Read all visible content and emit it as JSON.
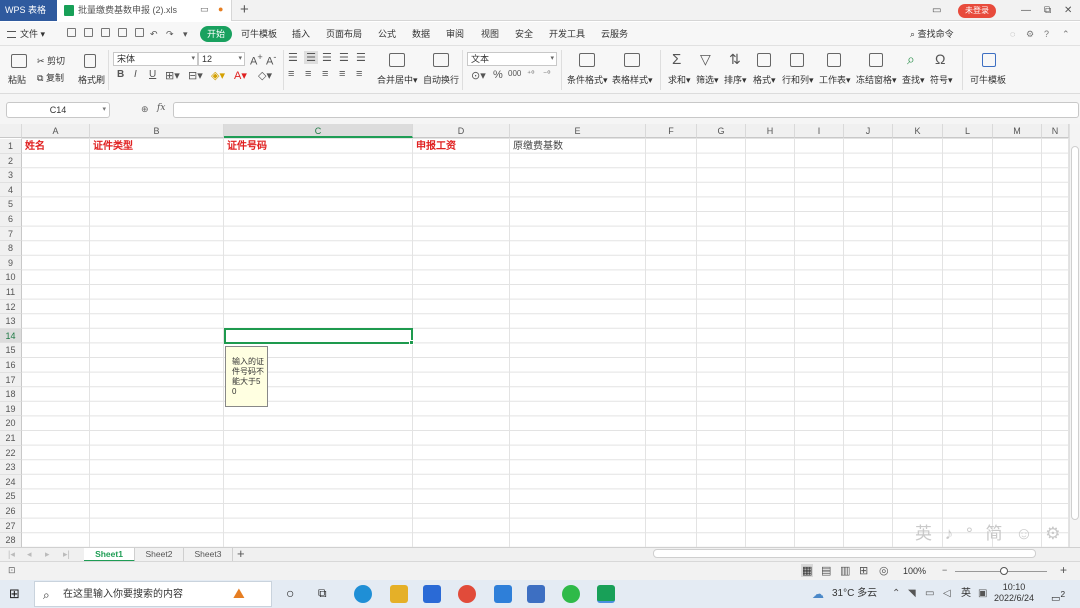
{
  "titlebar": {
    "brand": "WPS 表格",
    "file_tab": "批量缴费基数申报 (2).xls",
    "login": "未登录"
  },
  "menu": {
    "file": "文件",
    "items": [
      "开始",
      "可牛模板",
      "插入",
      "页面布局",
      "公式",
      "数据",
      "审阅",
      "视图",
      "安全",
      "开发工具",
      "云服务"
    ],
    "search": "查找命令"
  },
  "ribbon": {
    "paste": "粘贴",
    "cut": "剪切",
    "copy": "复制",
    "format_painter": "格式刷",
    "font": "宋体",
    "font_size": "12",
    "merge": "合并居中",
    "wrap": "自动换行",
    "number_format": "文本",
    "conditional": "条件格式",
    "table_style": "表格样式",
    "sum": "求和",
    "filter": "筛选",
    "sort": "排序",
    "format": "格式",
    "rows_cols": "行和列",
    "worksheet": "工作表",
    "freeze": "冻结窗格",
    "find": "查找",
    "symbol": "符号",
    "keniu": "可牛模板"
  },
  "formula_bar": {
    "name_box": "C14",
    "fx": "fx",
    "value": ""
  },
  "grid": {
    "columns": [
      "A",
      "B",
      "C",
      "D",
      "E",
      "F",
      "G",
      "H",
      "I",
      "J",
      "K",
      "L",
      "M",
      "N"
    ],
    "header_row": {
      "a": "姓名",
      "b": "证件类型",
      "c": "证件号码",
      "d": "申报工资",
      "e": "原缴费基数"
    },
    "rows": [
      "1",
      "2",
      "3",
      "4",
      "5",
      "6",
      "7",
      "8",
      "9",
      "10",
      "11",
      "12",
      "13",
      "14",
      "15",
      "16",
      "17",
      "18",
      "19",
      "20",
      "21",
      "22",
      "23",
      "24",
      "25",
      "26",
      "27",
      "28"
    ],
    "tooltip": "输入的证件号码不能大于50"
  },
  "sheets": [
    "Sheet1",
    "Sheet2",
    "Sheet3"
  ],
  "status": {
    "zoom": "100%"
  },
  "taskbar": {
    "search_placeholder": "在这里输入你要搜索的内容",
    "weather": "31°C 多云",
    "ime": "英",
    "time": "10:10",
    "date": "2022/6/24",
    "notifications": "2"
  },
  "watermark": "英 ♪ ° 简 ☺ ⚙"
}
